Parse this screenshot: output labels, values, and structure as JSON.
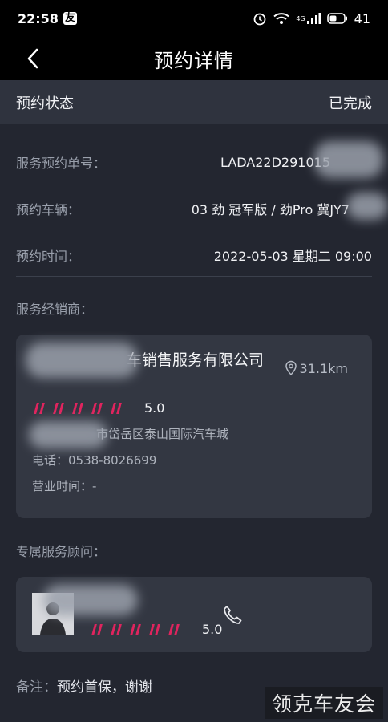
{
  "status_bar": {
    "time": "22:58",
    "carrier_badge": "友",
    "network": "4G",
    "battery": "41"
  },
  "nav": {
    "title": "预约详情"
  },
  "reservation_status": {
    "label": "预约状态",
    "value": "已完成"
  },
  "details": [
    {
      "label": "服务预约单号：",
      "value": "LADA22D291015"
    },
    {
      "label": "预约车辆：",
      "value": "03 劲 冠军版 / 劲Pro 冀JY7"
    },
    {
      "label": "预约时间：",
      "value": "2022-05-03 星期二 09:00"
    }
  ],
  "dealer_section": {
    "label": "服务经销商：",
    "name": "车销售服务有限公司",
    "distance": "31.1km",
    "rating": "5.0",
    "rating_stars": 5,
    "address": "市岱岳区泰山国际汽车城",
    "phone": "电话：0538-8026699",
    "hours": "营业时间：-"
  },
  "advisor_section": {
    "label": "专属服务顾问：",
    "rating": "5.0",
    "rating_stars": 5
  },
  "remark": {
    "label": "备注：",
    "value": "预约首保，谢谢"
  },
  "watermark": "领克车友会",
  "colors": {
    "accent": "#e0245e",
    "background": "#232630",
    "card": "#333742"
  }
}
